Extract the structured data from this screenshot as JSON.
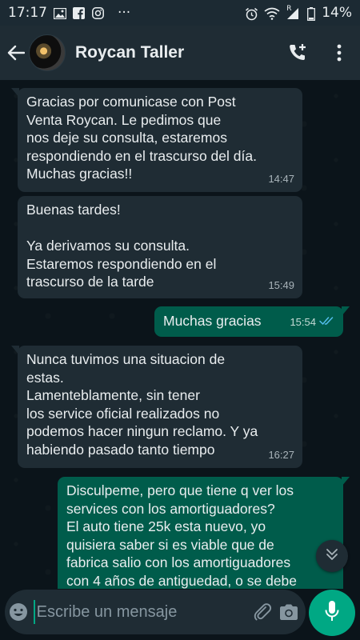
{
  "status_bar": {
    "time": "17:17",
    "dots": "···",
    "battery_pct": "14%",
    "signal_label": "R",
    "left_icons": [
      "image-icon",
      "facebook-icon",
      "instagram-icon"
    ],
    "right_icons": [
      "alarm-icon",
      "wifi-icon",
      "signal-icon",
      "battery-icon"
    ]
  },
  "header": {
    "contact_name": "Roycan Taller",
    "icons": [
      "back-arrow-icon",
      "add-call-icon",
      "more-vert-icon"
    ]
  },
  "messages": [
    {
      "direction": "in",
      "text": "Gracias por comunicase con Post\nVenta Roycan. Le pedimos que\nnos deje su consulta, estaremos\nrespondiendo en el trascurso del día.\nMuchas gracias!!",
      "time": "14:47"
    },
    {
      "direction": "in",
      "text": "Buenas tardes!\n\nYa derivamos su consulta.\nEstaremos respondiendo en el\ntrascurso de la tarde",
      "time": "15:49"
    },
    {
      "direction": "out",
      "text": "Muchas gracias",
      "time": "15:54",
      "status": "read"
    },
    {
      "direction": "in",
      "text": "Nunca tuvimos una situacion de\nestas.\nLamenteblamente, sin tener\nlos service oficial realizados no\npodemos hacer ningun reclamo. Y ya\nhabiendo pasado tanto tiempo",
      "time": "16:27"
    },
    {
      "direction": "out",
      "text": "Disculpeme, pero que tiene q ver los\nservices con los amortiguadores?\nEl auto tiene 25k esta nuevo, yo\nquisiera saber si es viable que de\nfabrica salio con los amortiguadores\ncon 4 años de antiguedad, o se debe",
      "time": ""
    }
  ],
  "composer": {
    "placeholder": "Escribe un mensaje",
    "icons": [
      "emoji-icon",
      "attach-icon",
      "camera-icon",
      "mic-icon",
      "chevron-double-down-icon"
    ]
  },
  "colors": {
    "header_bg": "#1f2c34",
    "chat_bg": "#0b141a",
    "incoming_bubble": "#1f2c34",
    "outgoing_bubble": "#005c4b",
    "accent": "#00a884",
    "read_ticks": "#53bdeb"
  }
}
